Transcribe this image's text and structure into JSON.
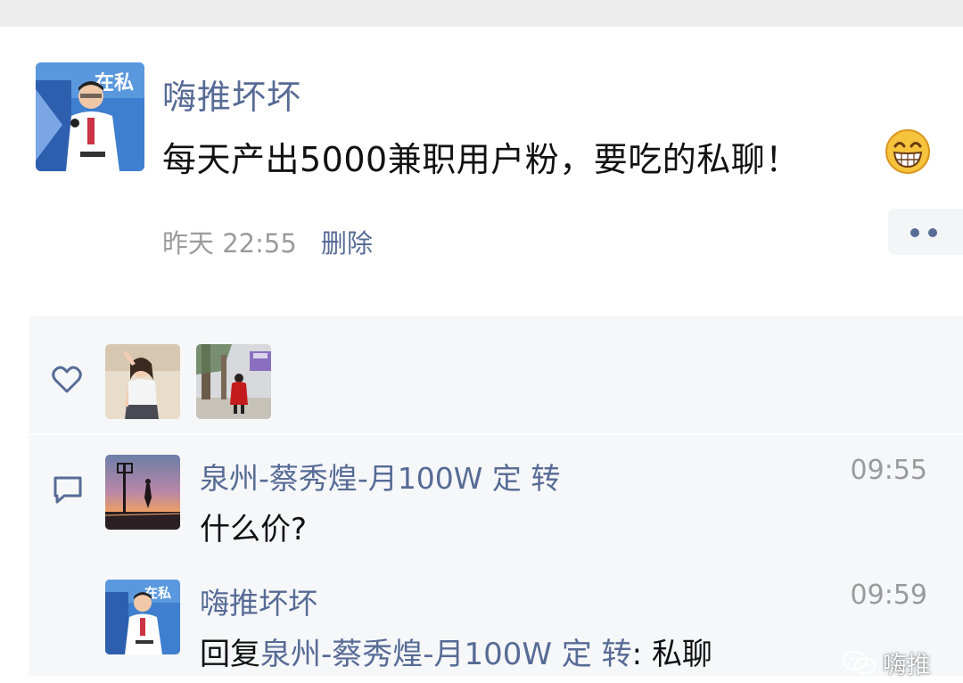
{
  "post": {
    "author": "嗨推坏坏",
    "text": "每天产出5000兼职用户粉，要吃的私聊！",
    "emoji": "grinning-face-icon",
    "time": "昨天 22:55",
    "delete_label": "删除"
  },
  "likes": {
    "icon": "heart-icon",
    "users": [
      "liker-avatar-1",
      "liker-avatar-2"
    ]
  },
  "comments": {
    "icon": "comment-icon",
    "items": [
      {
        "name": "泉州-蔡秀煌-月100W 定 转",
        "time": "09:55",
        "text": "什么价?"
      },
      {
        "name": "嗨推坏坏",
        "time": "09:59",
        "reply_prefix": "回复",
        "reply_to": "泉州-蔡秀煌-月100W 定 转",
        "reply_sep": ": ",
        "text": "私聊"
      }
    ]
  },
  "watermark": {
    "text": "嗨推"
  },
  "colors": {
    "link": "#576b95",
    "meta": "#9b9b9b",
    "panel": "#f6f7f9"
  }
}
